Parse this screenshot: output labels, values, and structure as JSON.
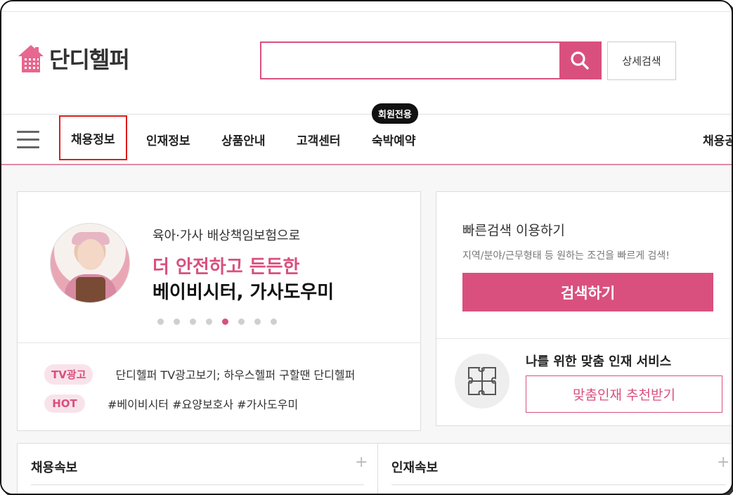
{
  "header": {
    "logo_text": "단디헬퍼",
    "search": {
      "placeholder": "",
      "value": ""
    },
    "advanced_search_label": "상세검색"
  },
  "nav": {
    "items": [
      {
        "label": "채용정보",
        "active": true
      },
      {
        "label": "인재정보"
      },
      {
        "label": "상품안내"
      },
      {
        "label": "고객센터"
      },
      {
        "label": "숙박예약"
      },
      {
        "label": "채용공"
      }
    ],
    "badge": "회원전용"
  },
  "banner": {
    "line1": "육아·가사 배상책임보험으로",
    "line2": "더 안전하고 든든한",
    "line3": "베이비시터, 가사도우미",
    "dots_total": 8,
    "dots_active_index": 4
  },
  "tags": [
    {
      "pill": "TV광고",
      "text": "단디헬퍼 TV광고보기; 하우스헬퍼 구할땐 단디헬퍼"
    },
    {
      "pill": "HOT",
      "text": "#베이비시터 #요양보호사 #가사도우미"
    }
  ],
  "quick_search": {
    "title": "빠른검색 이용하기",
    "subtitle": "지역/분야/근무형태 등 원하는 조건을 빠르게 검색!",
    "button_label": "검색하기"
  },
  "matching": {
    "title": "나를 위한 맞춤 인재 서비스",
    "button_label": "맞춤인재 추천받기"
  },
  "sections": {
    "left_title": "채용속보",
    "right_title": "인재속보",
    "plus_symbol": "+"
  },
  "colors": {
    "brand_pink": "#d9507f",
    "active_border": "#e01b1b"
  }
}
